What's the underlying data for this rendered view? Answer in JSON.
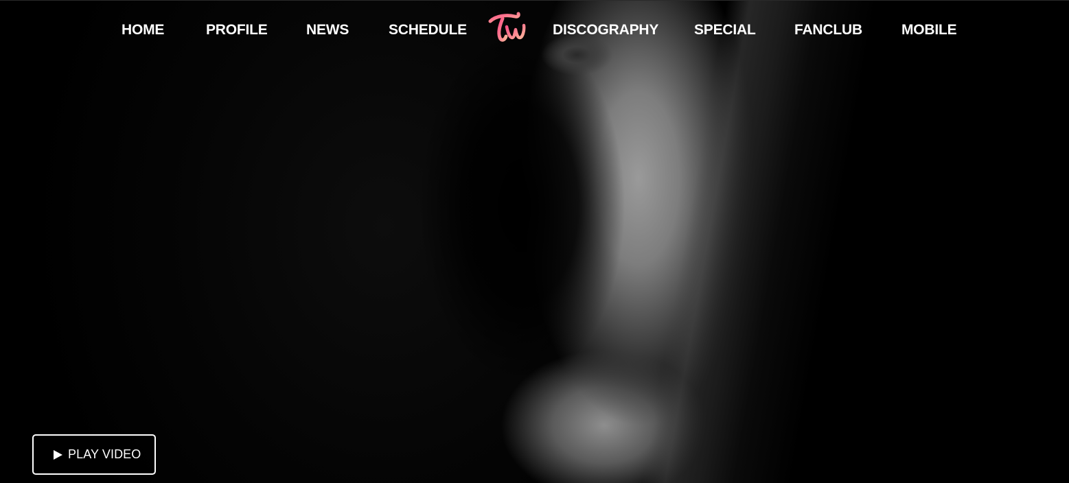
{
  "nav": {
    "items": [
      {
        "label": "HOME"
      },
      {
        "label": "PROFILE"
      },
      {
        "label": "NEWS"
      },
      {
        "label": "SCHEDULE"
      },
      {
        "label": "DISCOGRAPHY"
      },
      {
        "label": "SPECIAL"
      },
      {
        "label": "FANCLUB"
      },
      {
        "label": "MOBILE"
      }
    ],
    "logo": {
      "icon": "tw-logo-icon",
      "text": "TW",
      "color_start": "#ff5f8e",
      "color_end": "#ffb0a0"
    }
  },
  "hero": {
    "play_button": {
      "label": "PLAY VIDEO",
      "icon": "play-icon"
    }
  },
  "colors": {
    "background": "#000000",
    "text": "#ffffff",
    "accent": "#ff6f96"
  }
}
